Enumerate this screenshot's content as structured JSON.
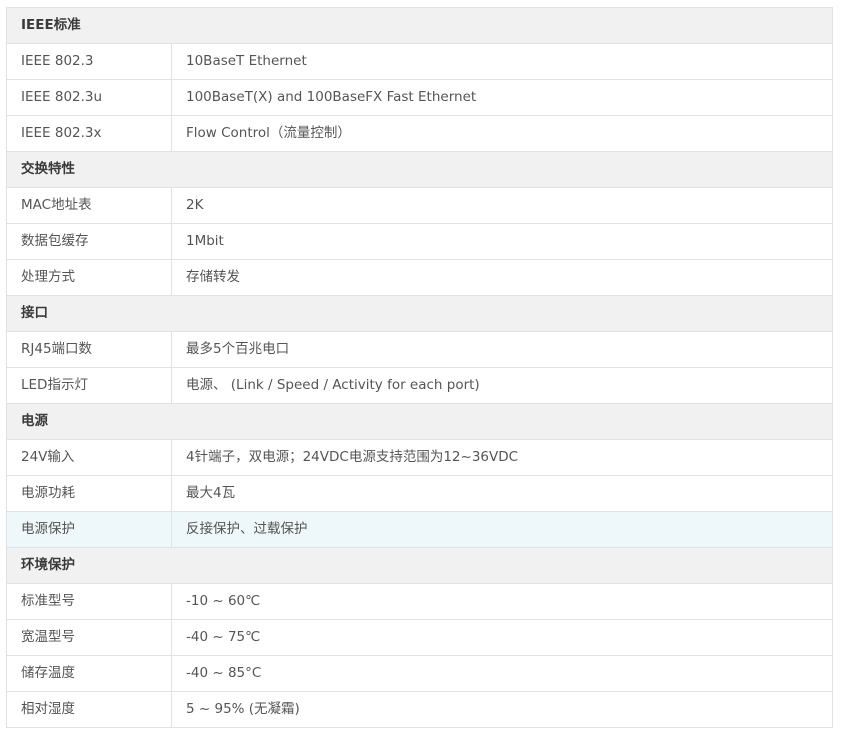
{
  "sections": [
    {
      "title": "IEEE标准",
      "rows": [
        {
          "label": "IEEE 802.3",
          "value": "10BaseT Ethernet"
        },
        {
          "label": "IEEE 802.3u",
          "value": "100BaseT(X) and 100BaseFX Fast Ethernet"
        },
        {
          "label": "IEEE 802.3x",
          "value": "Flow Control（流量控制）"
        }
      ]
    },
    {
      "title": "交换特性",
      "rows": [
        {
          "label": "MAC地址表",
          "value": "2K"
        },
        {
          "label": "数据包缓存",
          "value": "1Mbit"
        },
        {
          "label": "处理方式",
          "value": "存储转发"
        }
      ]
    },
    {
      "title": "接口",
      "rows": [
        {
          "label": "RJ45端口数",
          "value": "最多5个百兆电口"
        },
        {
          "label": "LED指示灯",
          "value": "电源、 (Link / Speed / Activity for each port)"
        }
      ]
    },
    {
      "title": "电源",
      "rows": [
        {
          "label": "24V输入",
          "value": "4针端子，双电源；24VDC电源支持范围为12~36VDC"
        },
        {
          "label": "电源功耗",
          "value": "最大4瓦"
        },
        {
          "label": "电源保护",
          "value": "反接保护、过载保护"
        }
      ]
    },
    {
      "title": "环境保护",
      "rows": [
        {
          "label": "标准型号",
          "value": "-10 ~ 60℃"
        },
        {
          "label": "宽温型号",
          "value": "-40 ~ 75℃"
        },
        {
          "label": "储存温度",
          "value": "-40 ~ 85°C"
        },
        {
          "label": "相对湿度",
          "value": "5 ~ 95% (无凝霜)"
        }
      ]
    }
  ]
}
